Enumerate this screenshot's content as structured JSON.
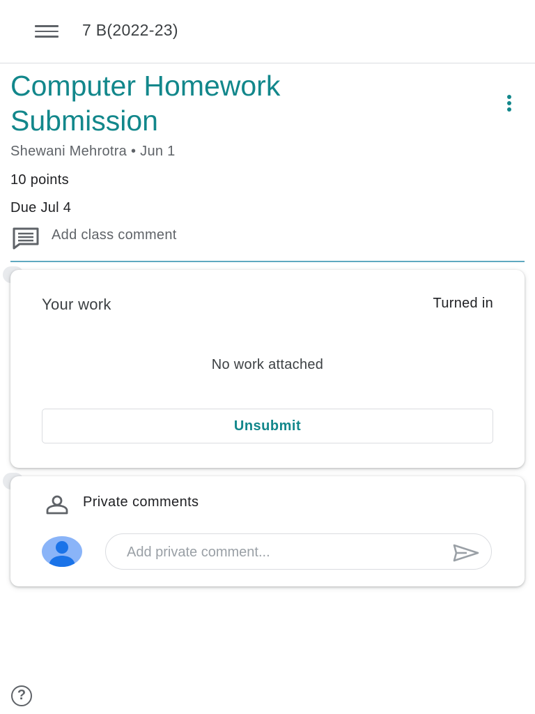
{
  "appbar": {
    "class_name": "7 B(2022-23)",
    "menu_icon": "hamburger-menu-icon"
  },
  "assignment": {
    "title": "Computer Homework Submission",
    "author": "Shewani Mehrotra",
    "separator": "•",
    "posted_date": "Jun 1",
    "points": "10 points",
    "due": "Due Jul 4",
    "more_icon": "more-vert-icon",
    "class_comment_label": "Add class comment",
    "class_comment_icon": "comment-icon"
  },
  "your_work": {
    "title": "Your work",
    "status": "Turned in",
    "empty_text": "No work attached",
    "unsubmit_label": "Unsubmit"
  },
  "private_comments": {
    "title": "Private comments",
    "title_icon": "person-outline-icon",
    "placeholder": "Add private comment...",
    "send_icon": "send-icon",
    "avatar_icon": "default-avatar-icon"
  },
  "help_icon": "help-icon",
  "colors": {
    "accent": "#12878b",
    "divider": "#5fa8c0",
    "avatar_bg": "#8ab4f8",
    "avatar_fg": "#1a73e8"
  }
}
